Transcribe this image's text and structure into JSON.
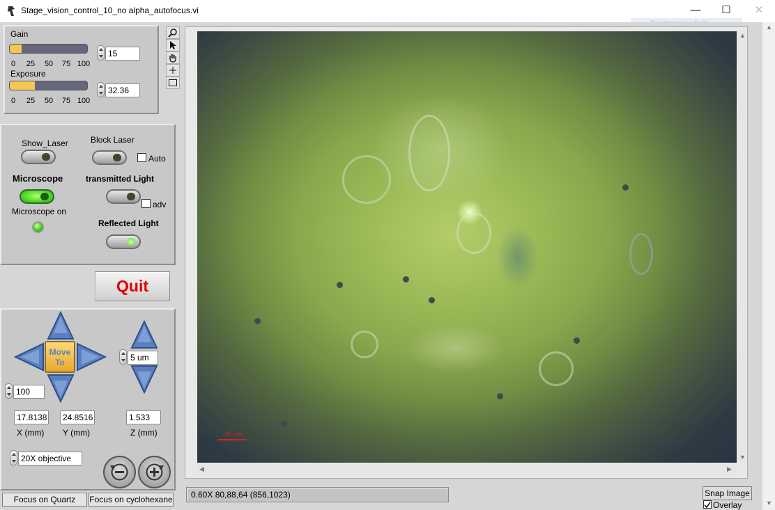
{
  "window": {
    "title": "Stage_vision_control_10_no alpha_autofocus.vi",
    "min": "—",
    "max": "☐",
    "close": "✕"
  },
  "ghost_snip": "Rectangular Snip",
  "gain": {
    "label": "Gain",
    "value": "15",
    "level_pct": 15,
    "ticks": [
      "0",
      "25",
      "50",
      "75",
      "100"
    ]
  },
  "exposure": {
    "label": "Exposure",
    "value": "32.36",
    "level_pct": 32.36,
    "ticks": [
      "0",
      "25",
      "50",
      "75",
      "100"
    ]
  },
  "laser": {
    "show_laser": "Show_Laser",
    "block_laser": "Block Laser",
    "auto": "Auto",
    "microscope": "Microscope",
    "microscope_on": "Microscope on",
    "transmitted": "transmitted Light",
    "adv": "adv",
    "reflected": "Reflected Light"
  },
  "quit_label": "Quit",
  "stage": {
    "move_to": [
      "Move",
      "To"
    ],
    "step": "5 um",
    "speed": "100",
    "x": "17.8138",
    "y": "24.8516",
    "z": "1.533",
    "x_label": "X (mm)",
    "y_label": "Y (mm)",
    "z_label": "Z (mm)",
    "objective": "20X objective"
  },
  "focus_quartz": "Focus on Quartz",
  "focus_cyclohexane": "Focus on cyclohexane",
  "scale_label": "25 um",
  "status": "0.60X 80,88,64    (856,1023)",
  "snap_image": "Snap Image",
  "overlay": "Overlay",
  "colors": {
    "panel": "#c8c8c8",
    "quit": "#e00000",
    "slider_fill": "#f4c753",
    "arrow_blue": "#5a7fbf"
  },
  "icons": [
    "zoom-icon",
    "pointer-icon",
    "hand-icon",
    "crosshair-icon",
    "rect-select-icon",
    "rotate-ccw-icon",
    "rotate-cw-icon"
  ]
}
